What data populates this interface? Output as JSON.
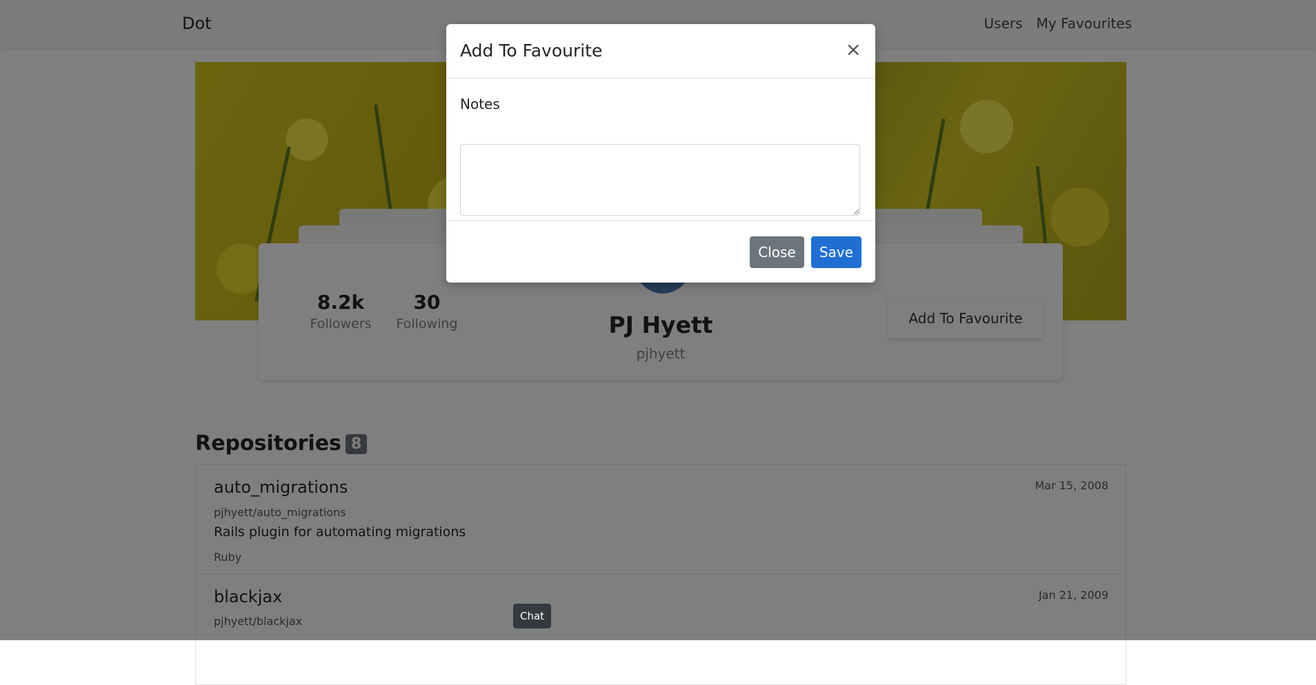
{
  "navbar": {
    "brand": "Dot",
    "links": [
      "Users",
      "My Favourites"
    ]
  },
  "profile": {
    "followers_count": "8.2k",
    "followers_label": "Followers",
    "following_count": "30",
    "following_label": "Following",
    "name": "PJ Hyett",
    "username": "pjhyett",
    "favourite_button": "Add To Favourite"
  },
  "repositories": {
    "heading": "Repositories",
    "count": "8",
    "items": [
      {
        "name": "auto_migrations",
        "full_name": "pjhyett/auto_migrations",
        "description": "Rails plugin for automating migrations",
        "language": "Ruby",
        "date": "Mar 15, 2008"
      },
      {
        "name": "blackjax",
        "full_name": "pjhyett/blackjax",
        "description": "",
        "language": "",
        "date": "Jan 21, 2009"
      }
    ]
  },
  "modal": {
    "title": "Add To Favourite",
    "close_icon": "×",
    "notes_label": "Notes",
    "notes_value": "",
    "close_button": "Close",
    "save_button": "Save"
  },
  "chat": {
    "label": "Chat"
  }
}
